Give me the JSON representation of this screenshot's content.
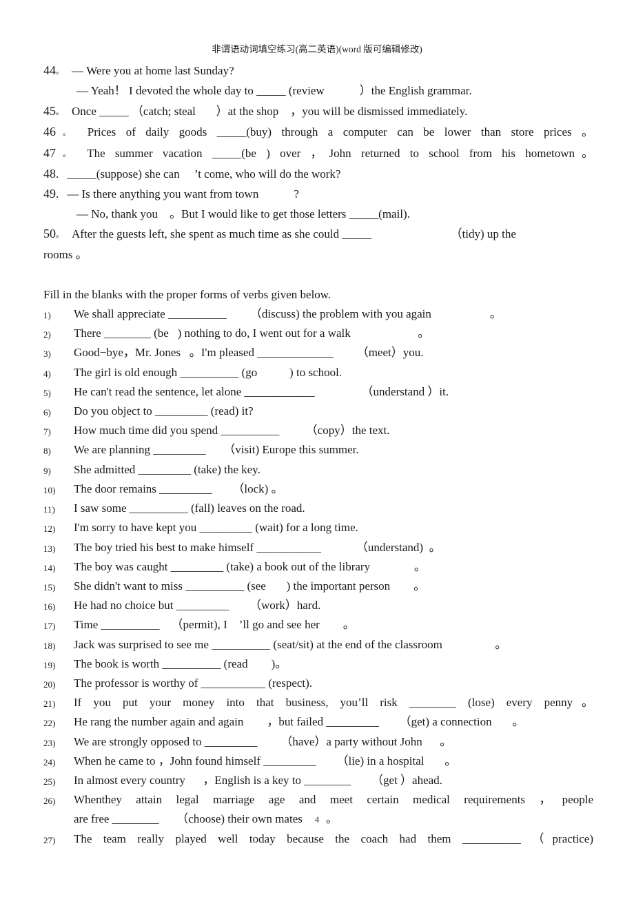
{
  "document": {
    "header_title": "非谓语动词填空练习(高二英语)(word  版可编辑修改)",
    "page_number": "4"
  },
  "top_questions": [
    {
      "number": "44",
      "number_mark": "。",
      "lines": [
        "— Were you at home last Sunday?",
        "— Yeah！ I devoted the whole day to _____ (review            ）the English grammar."
      ]
    },
    {
      "number": "45",
      "number_mark": "。",
      "lines": [
        "Once _____ （catch; steal       ）at the shop    ，you will be dismissed immediately."
      ]
    },
    {
      "number": "46",
      "number_mark": "。",
      "justified": true,
      "lines": [
        "Prices of daily goods _____(buy) through a computer can be lower than store prices 。"
      ]
    },
    {
      "number": "47",
      "number_mark": "。",
      "justified": true,
      "lines": [
        "The summer vacation _____(be ) over ，John returned to school from his hometown。"
      ]
    },
    {
      "number": "48",
      "number_mark": ".",
      "lines": [
        "_____(suppose) she can     ’t come, who will do the work?"
      ]
    },
    {
      "number": "49",
      "number_mark": ".",
      "lines": [
        "— Is there anything you want from town            ?",
        "— No, thank you    。But I would like to get those letters _____(mail)."
      ]
    },
    {
      "number": "50",
      "number_mark": "。",
      "lines": [
        "After the guests left, she spent as much time as she could _____                           （tidy) up the",
        "rooms 。"
      ]
    }
  ],
  "instruction": "Fill in the blanks with the proper forms of verbs given below.",
  "exercises": [
    {
      "marker": "1)",
      "text": "We shall appreciate __________        （discuss) the problem with you again                    。"
    },
    {
      "marker": "2)",
      "text": "There ________ (be   ) nothing to do, I went out for a walk                       。"
    },
    {
      "marker": "3)",
      "text": "Good−bye，Mr. Jones   。I'm pleased _____________        （meet）you."
    },
    {
      "marker": "4)",
      "text": "The girl is old enough __________ (go           ) to school."
    },
    {
      "marker": "5)",
      "text": "He can't read the sentence, let alone ____________                （understand ）it."
    },
    {
      "marker": "6)",
      "text": "Do you object to _________ (read) it?"
    },
    {
      "marker": "7)",
      "text": "How much time did you spend __________         （copy）the text."
    },
    {
      "marker": "8)",
      "text": "We are planning _________      （visit) Europe this summer."
    },
    {
      "marker": "9)",
      "text": "She admitted _________ (take) the key."
    },
    {
      "marker": "10)",
      "text": "The door remains _________       （lock) 。"
    },
    {
      "marker": "11)",
      "text": "I saw some __________ (fall) leaves on the road."
    },
    {
      "marker": "12)",
      "text": "I'm sorry to have kept you _________ (wait) for a long time."
    },
    {
      "marker": "13)",
      "text": "The boy tried his best to make himself ___________            （understand)  。"
    },
    {
      "marker": "14)",
      "text": "The boy was caught _________ (take) a book out of the library               。"
    },
    {
      "marker": "15)",
      "text": "She didn't want to miss __________ (see       ) the important person        。"
    },
    {
      "marker": "16)",
      "text": "He had no choice but _________       （work）hard."
    },
    {
      "marker": "17)",
      "text": "Time __________    （permit), I    ’ll go and see her        。"
    },
    {
      "marker": "18)",
      "text": "Jack was surprised to see me __________ (seat/sit) at the end of the classroom                  。"
    },
    {
      "marker": "19)",
      "text": "The book is worth __________ (read        )。"
    },
    {
      "marker": "20)",
      "text": "The professor is worthy of ___________ (respect)."
    },
    {
      "marker": "21)",
      "justified": true,
      "text": "If you put your money into that business, you’ll risk ________ (lose) every penny。"
    },
    {
      "marker": "22)",
      "text": "He rang the number again and again        ，but failed _________       （get) a connection       。"
    },
    {
      "marker": "23)",
      "text": "We are strongly opposed to _________        （have）a party without John      。"
    },
    {
      "marker": "24)",
      "text": "When he came to ，John found himself _________       （lie) in a hospital       。"
    },
    {
      "marker": "25)",
      "text": "In almost every country      ，English is a key to ________       （get ）ahead."
    },
    {
      "marker": "26)",
      "justified": true,
      "text": "Whenthey attain legal marriage age and meet certain medical requirements ，people",
      "text2": "are free ________      （choose) their own mates        。"
    },
    {
      "marker": "27)",
      "justified": true,
      "text": "The team really played well today because the coach had them __________ （practice)"
    }
  ]
}
